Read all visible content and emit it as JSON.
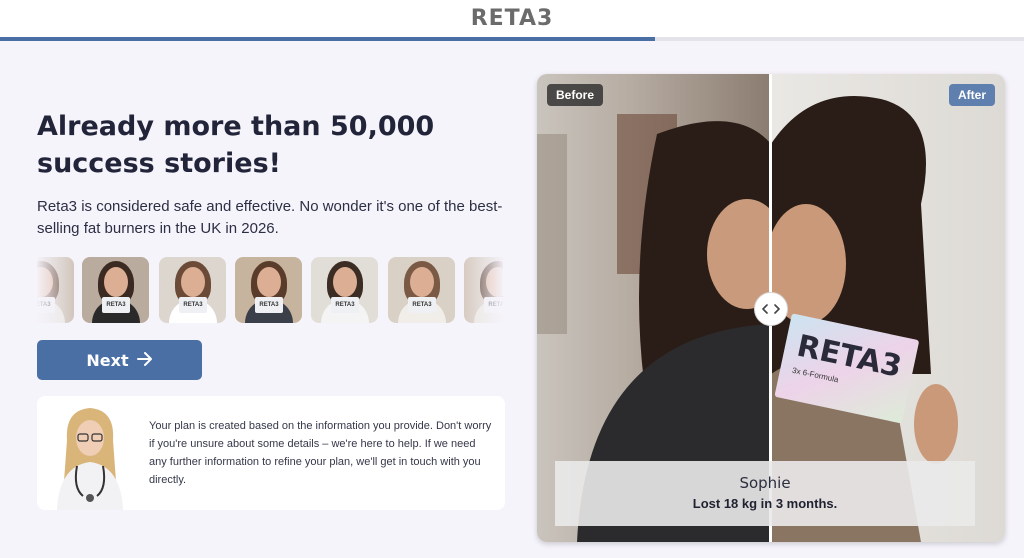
{
  "header": {
    "logo": "RETA3",
    "progress_percent": 64
  },
  "main": {
    "headline": "Already more than 50,000 success stories!",
    "subtext": "Reta3 is considered safe and effective. No wonder it's one of the best-selling fat burners in the UK in 2026.",
    "thumbnails": [
      {
        "bg": "#cfc3b8",
        "shirt": "#e9e6e2",
        "hair": "#6b4b3a"
      },
      {
        "bg": "#b9ab9e",
        "shirt": "#2a2a2a",
        "hair": "#3b2a22"
      },
      {
        "bg": "#dcd6cf",
        "shirt": "#ffffff",
        "hair": "#6b4a38"
      },
      {
        "bg": "#c7b49f",
        "shirt": "#3a3f4a",
        "hair": "#5a3c2b"
      },
      {
        "bg": "#e1ddd7",
        "shirt": "#f4f4f4",
        "hair": "#3b2c24"
      },
      {
        "bg": "#d9d0c6",
        "shirt": "#f1ede8",
        "hair": "#7a5a45"
      },
      {
        "bg": "#d6cbc0",
        "shirt": "#eae6e0",
        "hair": "#5a3f30"
      }
    ],
    "thumbnail_box_label": "RETA3",
    "next_label": "Next",
    "next_icon": "arrow-right-icon",
    "info_text": "Your plan is created based on the information you provide. Don't worry if you're unsure about some details – we're here to help. If we need any further information to refine your plan, we'll get in touch with you directly."
  },
  "comparison": {
    "before_label": "Before",
    "after_label": "After",
    "product_logo": "RETA3",
    "product_subtext": "3x 6-Formula",
    "handle_icon": "chevron-left-right-icon",
    "name": "Sophie",
    "result": "Lost 18 kg in 3 months.",
    "accent": "#4a6fa5"
  }
}
